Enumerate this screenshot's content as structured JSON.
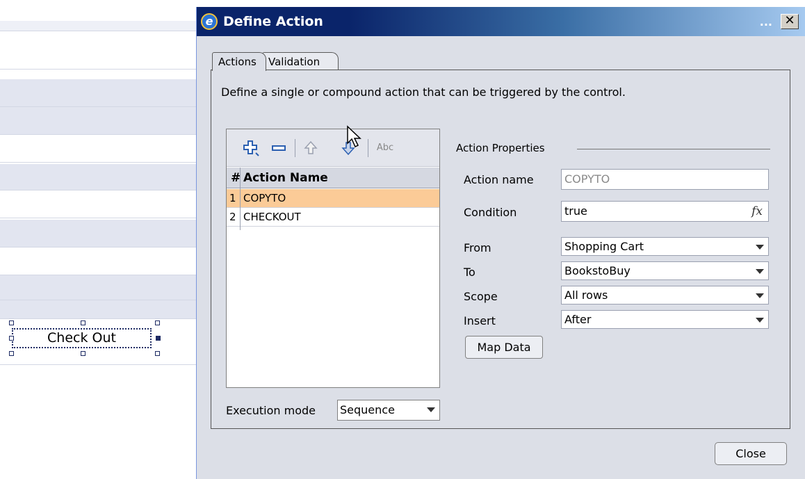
{
  "dialog": {
    "title": "Define Action",
    "title_ellipsis": "...",
    "close_x": "✕",
    "tabs": [
      {
        "label": "Actions",
        "active": true
      },
      {
        "label": "Validation",
        "active": false
      }
    ],
    "description": "Define a single or compound action that can be triggered by the control.",
    "actions_list": {
      "toolbar": [
        "add-icon",
        "remove-icon",
        "move-up-icon",
        "move-down-icon",
        "rename-icon"
      ],
      "rename_label": "Abc",
      "header_num": "#",
      "header_name": "Action Name",
      "rows": [
        {
          "num": "1",
          "name": "COPYTO",
          "selected": true
        },
        {
          "num": "2",
          "name": "CHECKOUT",
          "selected": false
        }
      ]
    },
    "execution_mode": {
      "label": "Execution mode",
      "value": "Sequence"
    },
    "properties": {
      "title": "Action Properties",
      "action_name_label": "Action name",
      "action_name_value": "COPYTO",
      "condition_label": "Condition",
      "condition_value": "true",
      "from_label": "From",
      "from_value": "Shopping Cart",
      "to_label": "To",
      "to_value": "BookstoBuy",
      "scope_label": "Scope",
      "scope_value": "All rows",
      "insert_label": "Insert",
      "insert_value": "After",
      "map_data_label": "Map Data"
    },
    "close_label": "Close"
  },
  "background": {
    "checkout_button_label": "Check Out"
  },
  "colors": {
    "selection": "#fbcb97",
    "titlebar_dark": "#0a246a",
    "titlebar_light": "#a6caf0",
    "panel": "#dcdfe7"
  }
}
